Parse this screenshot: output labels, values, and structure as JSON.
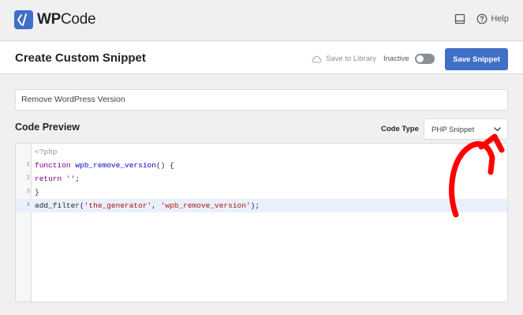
{
  "brand": {
    "name_bold": "WP",
    "name_rest": "Code",
    "accent": "#3f6fc7"
  },
  "topbar": {
    "help_label": "Help"
  },
  "header": {
    "title": "Create Custom Snippet",
    "save_to_library": "Save to Library",
    "status": "Inactive",
    "save_button": "Save Snippet"
  },
  "snippet": {
    "title_value": "Remove WordPress Version"
  },
  "code_preview": {
    "heading": "Code Preview",
    "code_type_label": "Code Type",
    "code_type_value": "PHP Snippet",
    "php_open_tag": "<?php",
    "lines": [
      {
        "num": "1",
        "parts": [
          [
            "kw",
            "function "
          ],
          [
            "fn",
            "wpb_remove_version"
          ],
          [
            "",
            "() {"
          ]
        ]
      },
      {
        "num": "2",
        "parts": [
          [
            "kw",
            "return "
          ],
          [
            "str",
            "''"
          ],
          [
            "",
            ";"
          ]
        ]
      },
      {
        "num": "3",
        "parts": [
          [
            "",
            "}"
          ]
        ]
      },
      {
        "num": "4",
        "parts": [
          [
            "",
            "add_filter("
          ],
          [
            "str",
            "'the_generator'"
          ],
          [
            "",
            ", "
          ],
          [
            "str",
            "'wpb_remove_version'"
          ],
          [
            "",
            ");"
          ]
        ]
      }
    ]
  },
  "annotation": {
    "arrow_color": "#ff0000"
  }
}
